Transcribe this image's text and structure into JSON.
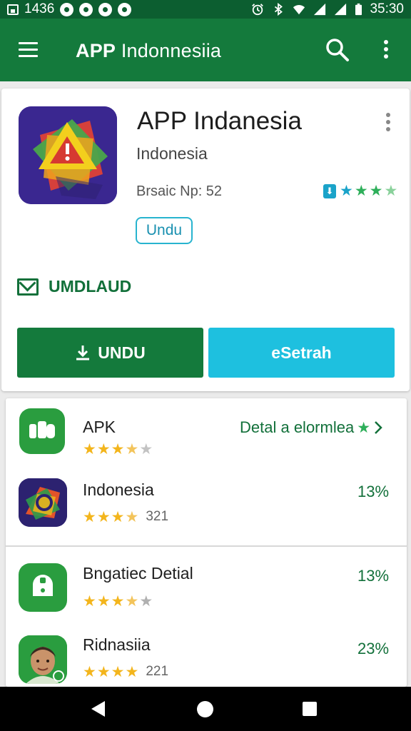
{
  "status_bar": {
    "time_left": "1436",
    "time_right": "35:30"
  },
  "app_bar": {
    "title_bold": "APP",
    "title_rest": " Indonnesiia"
  },
  "detail": {
    "title": "APP Indanesia",
    "subtitle": "Indonesia",
    "meta": "Brsaic Np: 52",
    "rating_stars": 3.5,
    "install_pill": "Undu",
    "section_label": "UMDLAUD",
    "primary_button": "UNDU",
    "secondary_button": "Setrah",
    "secondary_glyph": "e"
  },
  "list": {
    "detail_link": "Detal a elormlea",
    "items": [
      {
        "name": "APK",
        "rating": 3.5,
        "count": "",
        "pct": ""
      },
      {
        "name": "Indonesia",
        "rating": 3.5,
        "count": "321",
        "pct": "13%"
      },
      {
        "name": "Bngatiec Detial",
        "rating": 3.5,
        "count": "",
        "pct": "13%"
      },
      {
        "name": "Ridnasiia",
        "rating": 4,
        "count": "221",
        "pct": "23%"
      }
    ]
  },
  "colors": {
    "brand_green": "#147a3c",
    "status_green": "#0c5e30",
    "accent_cyan": "#1ec0df",
    "star_gold": "#f3b51c",
    "star_green": "#2eaf5a",
    "star_gray": "#c3c3c3"
  }
}
